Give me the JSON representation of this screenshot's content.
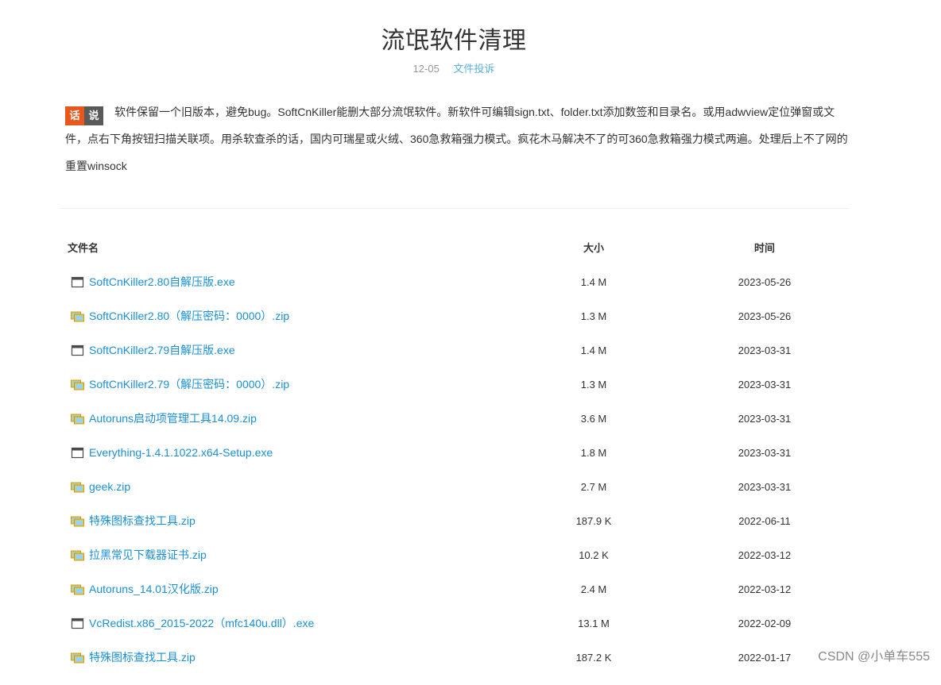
{
  "page": {
    "title": "流氓软件清理",
    "date": "12-05",
    "report_link": "文件投诉"
  },
  "intro": {
    "badge_left": "话",
    "badge_right": "说",
    "text": "软件保留一个旧版本，避免bug。SoftCnKiller能删大部分流氓软件。新软件可编辑sign.txt、folder.txt添加数签和目录名。或用adwview定位弹窗或文件，点右下角按钮扫描关联项。用杀软查杀的话，国内可瑞星或火绒、360急救箱强力模式。疯花木马解决不了的可360急救箱强力模式两遍。处理后上不了网的重置winsock"
  },
  "table": {
    "headers": {
      "name": "文件名",
      "size": "大小",
      "time": "时间"
    },
    "rows": [
      {
        "icon": "exe-window-icon",
        "name": "SoftCnKiller2.80自解压版.exe",
        "size": "1.4 M",
        "time": "2023-05-26"
      },
      {
        "icon": "zip-archive-icon",
        "name": "SoftCnKiller2.80（解压密码：0000）.zip",
        "size": "1.3 M",
        "time": "2023-05-26"
      },
      {
        "icon": "exe-window-icon",
        "name": "SoftCnKiller2.79自解压版.exe",
        "size": "1.4 M",
        "time": "2023-03-31"
      },
      {
        "icon": "zip-archive-icon",
        "name": "SoftCnKiller2.79（解压密码：0000）.zip",
        "size": "1.3 M",
        "time": "2023-03-31"
      },
      {
        "icon": "zip-archive-icon",
        "name": "Autoruns启动项管理工具14.09.zip",
        "size": "3.6 M",
        "time": "2023-03-31"
      },
      {
        "icon": "exe-window-icon",
        "name": "Everything-1.4.1.1022.x64-Setup.exe",
        "size": "1.8 M",
        "time": "2023-03-31"
      },
      {
        "icon": "zip-archive-icon",
        "name": "geek.zip",
        "size": "2.7 M",
        "time": "2023-03-31"
      },
      {
        "icon": "zip-archive-icon",
        "name": "特殊图标查找工具.zip",
        "size": "187.9 K",
        "time": "2022-06-11"
      },
      {
        "icon": "zip-archive-icon",
        "name": "拉黑常见下载器证书.zip",
        "size": "10.2 K",
        "time": "2022-03-12"
      },
      {
        "icon": "zip-archive-icon",
        "name": "Autoruns_14.01汉化版.zip",
        "size": "2.4 M",
        "time": "2022-03-12"
      },
      {
        "icon": "exe-window-icon",
        "name": "VcRedist.x86_2015-2022（mfc140u.dll）.exe",
        "size": "13.1 M",
        "time": "2022-02-09"
      },
      {
        "icon": "zip-archive-icon",
        "name": "特殊图标查找工具.zip",
        "size": "187.2 K",
        "time": "2022-01-17"
      }
    ]
  },
  "watermark": "CSDN @小单车555"
}
